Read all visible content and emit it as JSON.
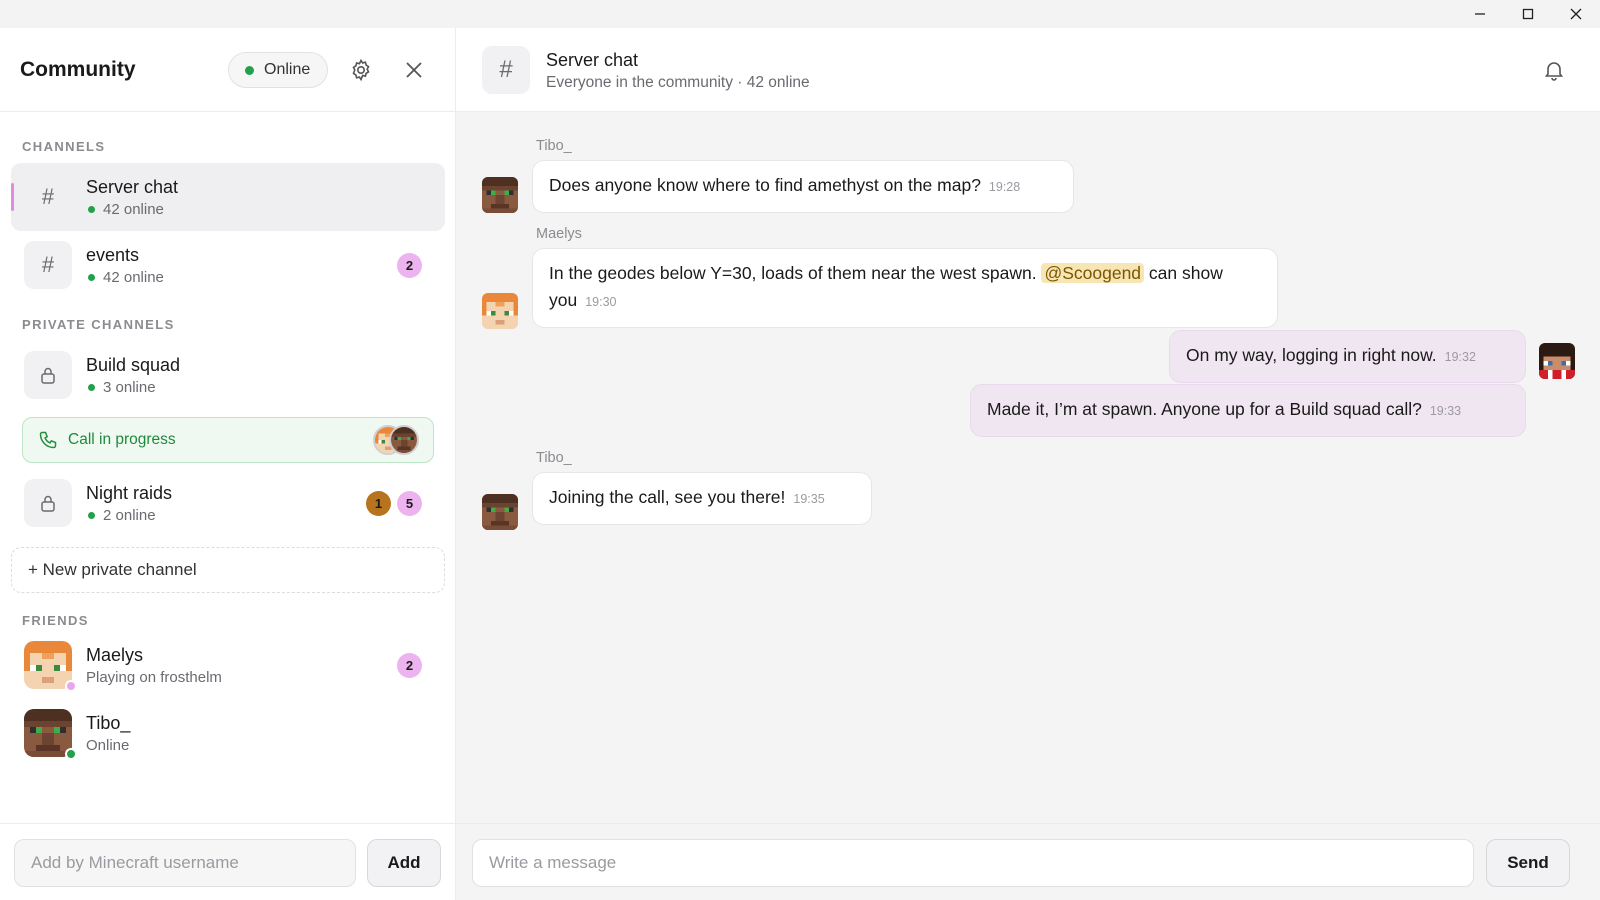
{
  "window": {
    "controls": [
      "minimize-icon",
      "maximize-icon",
      "close-icon"
    ]
  },
  "sidebar": {
    "title": "Community",
    "status": "Online",
    "status_color": "#22a04b",
    "sections": {
      "channels": "CHANNELS",
      "private": "PRIVATE CHANNELS",
      "friends": "FRIENDS"
    },
    "channels": [
      {
        "name": "Server chat",
        "online": "42 online",
        "active": true
      },
      {
        "name": "events",
        "online": "42 online",
        "badge": "2"
      }
    ],
    "private_channels": [
      {
        "name": "Build squad",
        "online": "3 online"
      },
      {
        "name": "Night raids",
        "online": "2 online",
        "badges": [
          "1",
          "5"
        ]
      }
    ],
    "call": {
      "label": "Call in progress"
    },
    "new_channel": "+ New private channel",
    "friends": [
      {
        "name": "Maelys",
        "status": "Playing on frosthelm",
        "badge": "2",
        "presence_color": "#e9a6ec"
      },
      {
        "name": "Tibo_",
        "status": "Online",
        "presence_color": "#22a04b"
      }
    ],
    "add_friend": {
      "placeholder": "Add by Minecraft username",
      "button": "Add"
    }
  },
  "chat": {
    "title": "Server chat",
    "subtitle": "Everyone in the community · 42 online",
    "messages": [
      {
        "sender": "Tibo_",
        "text": "Does anyone know where to find amethyst on the map?",
        "time": "19:28"
      },
      {
        "sender": "Maelys",
        "text_before": "In the geodes below Y=30, loads of them near the west spawn.",
        "mention": "@Scoogend",
        "text_after": "can show you",
        "time": "19:30"
      },
      {
        "sender": "me",
        "text": "On my way, logging in right now.",
        "time": "19:32"
      },
      {
        "sender": "me",
        "text": "Made it, I’m at spawn. Anyone up for a Build squad call?",
        "time": "19:33"
      },
      {
        "sender": "Tibo_",
        "text": "Joining the call, see you there!",
        "time": "19:35"
      }
    ],
    "composer": {
      "placeholder": "Write a message",
      "button": "Send"
    }
  },
  "colors": {
    "accent_pink": "#edb3ef",
    "badge_gold": "#b8731e",
    "mention_bg": "#f7e6b4",
    "own_bubble": "#f0e6f1",
    "call_green": "#1f8a3d"
  }
}
